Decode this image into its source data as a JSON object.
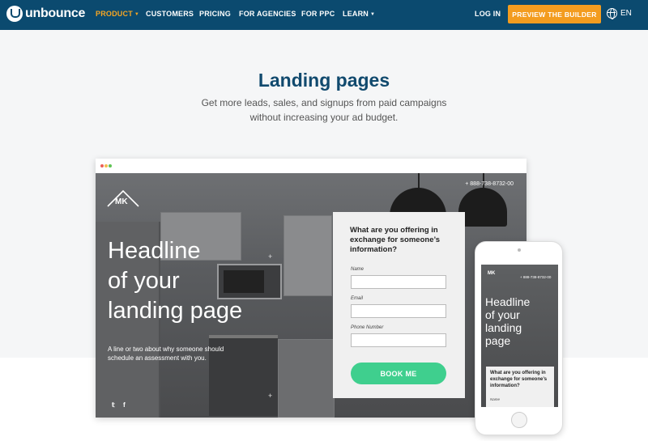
{
  "nav": {
    "logo": "unbounce",
    "items": [
      {
        "label": "PRODUCT",
        "active": true,
        "has_caret": true
      },
      {
        "label": "CUSTOMERS",
        "active": false
      },
      {
        "label": "PRICING",
        "active": false
      },
      {
        "label": "FOR AGENCIES",
        "active": false
      },
      {
        "label": "FOR PPC",
        "active": false
      },
      {
        "label": "LEARN",
        "active": false,
        "has_caret": true
      }
    ],
    "login": "LOG IN",
    "cta": "PREVIEW THE BUILDER",
    "language": "EN",
    "colors": {
      "background": "#0b4a6f",
      "active": "#f6a623",
      "cta": "#f39c1f"
    }
  },
  "hero": {
    "title": "Landing pages",
    "subtitle_line1": "Get more leads, sales, and signups from paid campaigns",
    "subtitle_line2": "without increasing your ad budget."
  },
  "desktop_mockup": {
    "brand": "MK",
    "phone": "+ 888-738-8732-00",
    "headline_line1": "Headline",
    "headline_line2": "of your",
    "headline_line3": "landing page",
    "desc_line1": "A line or two about why someone should",
    "desc_line2": "schedule an assessment with you.",
    "social": [
      "twitter-icon",
      "facebook-icon"
    ],
    "form": {
      "question": "What are you offering in exchange for someone’s information?",
      "fields": [
        {
          "label": "Name"
        },
        {
          "label": "Email"
        },
        {
          "label": "Phone Number"
        }
      ],
      "button": "BOOK ME",
      "button_color": "#3fcf8e"
    }
  },
  "mobile_mockup": {
    "brand": "MK",
    "phone": "+ 888-738-8732-00",
    "headline_line1": "Headline",
    "headline_line2": "of your",
    "headline_line3": "landing",
    "headline_line4": "page",
    "form_question": "What are you offering in exchange for someone’s information?",
    "field_label": "Name"
  }
}
